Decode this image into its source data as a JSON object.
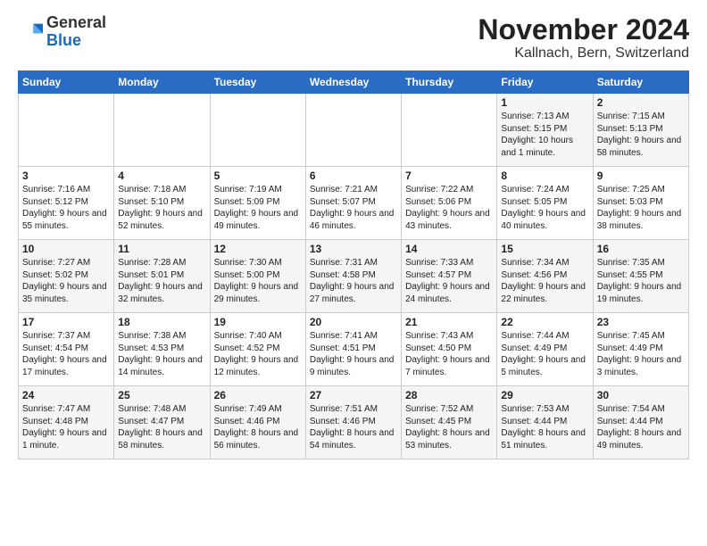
{
  "header": {
    "logo_general": "General",
    "logo_blue": "Blue",
    "month_title": "November 2024",
    "location": "Kallnach, Bern, Switzerland"
  },
  "weekdays": [
    "Sunday",
    "Monday",
    "Tuesday",
    "Wednesday",
    "Thursday",
    "Friday",
    "Saturday"
  ],
  "weeks": [
    [
      {
        "day": "",
        "info": ""
      },
      {
        "day": "",
        "info": ""
      },
      {
        "day": "",
        "info": ""
      },
      {
        "day": "",
        "info": ""
      },
      {
        "day": "",
        "info": ""
      },
      {
        "day": "1",
        "info": "Sunrise: 7:13 AM\nSunset: 5:15 PM\nDaylight: 10 hours and 1 minute."
      },
      {
        "day": "2",
        "info": "Sunrise: 7:15 AM\nSunset: 5:13 PM\nDaylight: 9 hours and 58 minutes."
      }
    ],
    [
      {
        "day": "3",
        "info": "Sunrise: 7:16 AM\nSunset: 5:12 PM\nDaylight: 9 hours and 55 minutes."
      },
      {
        "day": "4",
        "info": "Sunrise: 7:18 AM\nSunset: 5:10 PM\nDaylight: 9 hours and 52 minutes."
      },
      {
        "day": "5",
        "info": "Sunrise: 7:19 AM\nSunset: 5:09 PM\nDaylight: 9 hours and 49 minutes."
      },
      {
        "day": "6",
        "info": "Sunrise: 7:21 AM\nSunset: 5:07 PM\nDaylight: 9 hours and 46 minutes."
      },
      {
        "day": "7",
        "info": "Sunrise: 7:22 AM\nSunset: 5:06 PM\nDaylight: 9 hours and 43 minutes."
      },
      {
        "day": "8",
        "info": "Sunrise: 7:24 AM\nSunset: 5:05 PM\nDaylight: 9 hours and 40 minutes."
      },
      {
        "day": "9",
        "info": "Sunrise: 7:25 AM\nSunset: 5:03 PM\nDaylight: 9 hours and 38 minutes."
      }
    ],
    [
      {
        "day": "10",
        "info": "Sunrise: 7:27 AM\nSunset: 5:02 PM\nDaylight: 9 hours and 35 minutes."
      },
      {
        "day": "11",
        "info": "Sunrise: 7:28 AM\nSunset: 5:01 PM\nDaylight: 9 hours and 32 minutes."
      },
      {
        "day": "12",
        "info": "Sunrise: 7:30 AM\nSunset: 5:00 PM\nDaylight: 9 hours and 29 minutes."
      },
      {
        "day": "13",
        "info": "Sunrise: 7:31 AM\nSunset: 4:58 PM\nDaylight: 9 hours and 27 minutes."
      },
      {
        "day": "14",
        "info": "Sunrise: 7:33 AM\nSunset: 4:57 PM\nDaylight: 9 hours and 24 minutes."
      },
      {
        "day": "15",
        "info": "Sunrise: 7:34 AM\nSunset: 4:56 PM\nDaylight: 9 hours and 22 minutes."
      },
      {
        "day": "16",
        "info": "Sunrise: 7:35 AM\nSunset: 4:55 PM\nDaylight: 9 hours and 19 minutes."
      }
    ],
    [
      {
        "day": "17",
        "info": "Sunrise: 7:37 AM\nSunset: 4:54 PM\nDaylight: 9 hours and 17 minutes."
      },
      {
        "day": "18",
        "info": "Sunrise: 7:38 AM\nSunset: 4:53 PM\nDaylight: 9 hours and 14 minutes."
      },
      {
        "day": "19",
        "info": "Sunrise: 7:40 AM\nSunset: 4:52 PM\nDaylight: 9 hours and 12 minutes."
      },
      {
        "day": "20",
        "info": "Sunrise: 7:41 AM\nSunset: 4:51 PM\nDaylight: 9 hours and 9 minutes."
      },
      {
        "day": "21",
        "info": "Sunrise: 7:43 AM\nSunset: 4:50 PM\nDaylight: 9 hours and 7 minutes."
      },
      {
        "day": "22",
        "info": "Sunrise: 7:44 AM\nSunset: 4:49 PM\nDaylight: 9 hours and 5 minutes."
      },
      {
        "day": "23",
        "info": "Sunrise: 7:45 AM\nSunset: 4:49 PM\nDaylight: 9 hours and 3 minutes."
      }
    ],
    [
      {
        "day": "24",
        "info": "Sunrise: 7:47 AM\nSunset: 4:48 PM\nDaylight: 9 hours and 1 minute."
      },
      {
        "day": "25",
        "info": "Sunrise: 7:48 AM\nSunset: 4:47 PM\nDaylight: 8 hours and 58 minutes."
      },
      {
        "day": "26",
        "info": "Sunrise: 7:49 AM\nSunset: 4:46 PM\nDaylight: 8 hours and 56 minutes."
      },
      {
        "day": "27",
        "info": "Sunrise: 7:51 AM\nSunset: 4:46 PM\nDaylight: 8 hours and 54 minutes."
      },
      {
        "day": "28",
        "info": "Sunrise: 7:52 AM\nSunset: 4:45 PM\nDaylight: 8 hours and 53 minutes."
      },
      {
        "day": "29",
        "info": "Sunrise: 7:53 AM\nSunset: 4:44 PM\nDaylight: 8 hours and 51 minutes."
      },
      {
        "day": "30",
        "info": "Sunrise: 7:54 AM\nSunset: 4:44 PM\nDaylight: 8 hours and 49 minutes."
      }
    ]
  ]
}
